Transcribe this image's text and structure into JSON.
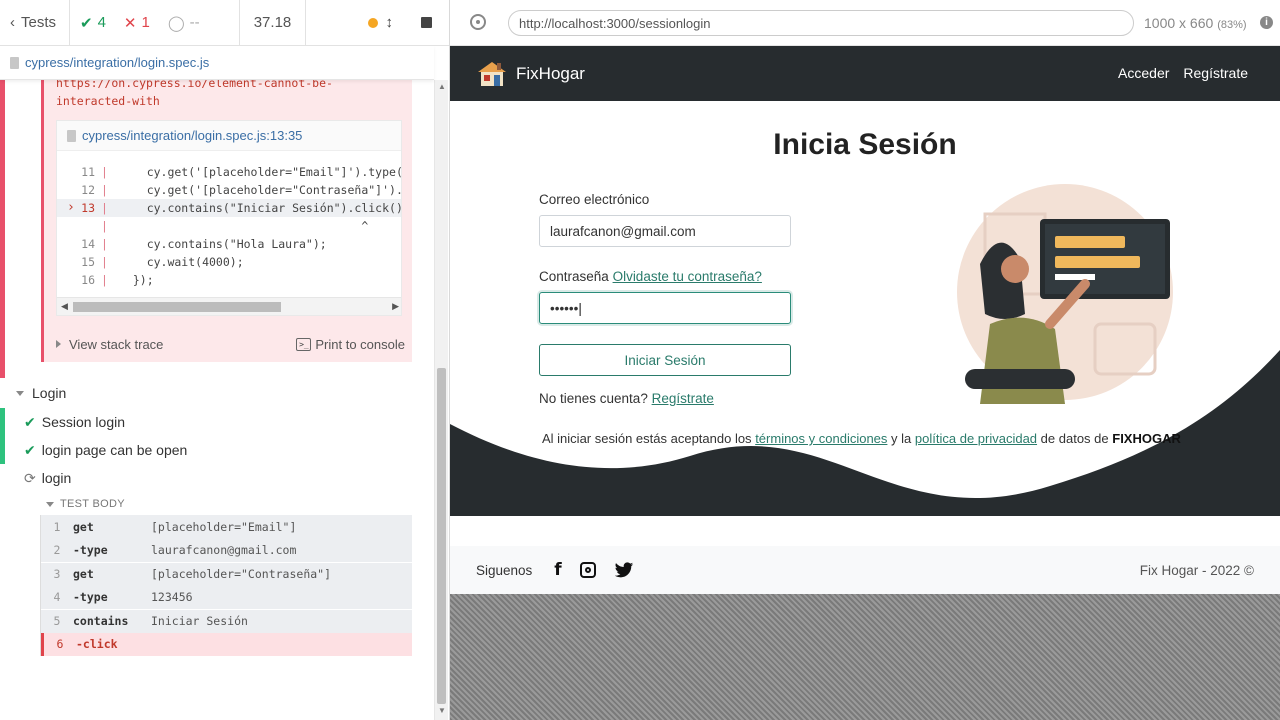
{
  "runner": {
    "tests_label": "Tests",
    "passed": "4",
    "failed": "1",
    "pending": "--",
    "duration": "37.18"
  },
  "spec": {
    "path": "cypress/integration/login.spec.js"
  },
  "error": {
    "link_text": "https://on.cypress.io/element-cannot-be-interacted-with",
    "frame_file": "cypress/integration/login.spec.js:13:35",
    "code_lines": [
      {
        "n": "11",
        "code": "    cy.get('[placeholder=\"Email\"]').type("
      },
      {
        "n": "12",
        "code": "    cy.get('[placeholder=\"Contraseña\"]')."
      },
      {
        "n": "13",
        "code": "    cy.contains(\"Iniciar Sesión\").click()"
      },
      {
        "n": "",
        "code": "                                   ^"
      },
      {
        "n": "14",
        "code": "    cy.contains(\"Hola Laura\");"
      },
      {
        "n": "15",
        "code": "    cy.wait(4000);"
      },
      {
        "n": "16",
        "code": "  });"
      }
    ],
    "view_stack": "View stack trace",
    "print_console": "Print to console"
  },
  "suite": {
    "title": "Login",
    "tests": [
      {
        "label": "Session login",
        "state": "passed"
      },
      {
        "label": "login page can be open",
        "state": "passed"
      },
      {
        "label": "login",
        "state": "running"
      }
    ],
    "body_header": "TEST BODY",
    "commands": [
      {
        "n": "1",
        "name": "get",
        "msg": "[placeholder=\"Email\"]"
      },
      {
        "n": "2",
        "name": "-type",
        "msg": "laurafcanon@gmail.com"
      },
      {
        "n": "3",
        "name": "get",
        "msg": "[placeholder=\"Contraseña\"]"
      },
      {
        "n": "4",
        "name": "-type",
        "msg": "123456"
      },
      {
        "n": "5",
        "name": "contains",
        "msg": "Iniciar Sesión"
      },
      {
        "n": "6",
        "name": "-click",
        "msg": ""
      }
    ]
  },
  "browser": {
    "url": "http://localhost:3000/sessionlogin",
    "viewport": "1000 x 660",
    "zoom": "(83%)"
  },
  "app": {
    "brand": "FixHogar",
    "nav_login": "Acceder",
    "nav_register": "Regístrate",
    "title": "Inicia Sesión",
    "email_label": "Correo electrónico",
    "email_value": "laurafcanon@gmail.com",
    "password_label": "Contraseña",
    "forgot_link": "Olvidaste tu contraseña?",
    "password_value": "••••••",
    "submit": "Iniciar Sesión",
    "no_account": "No tienes cuenta?",
    "register_link": "Regístrate",
    "terms_pre": "Al iniciar sesión estás aceptando los",
    "terms_link": "términos y condiciones",
    "terms_mid": "y la",
    "privacy_link": "política de privacidad",
    "terms_post": "de datos de",
    "terms_brand": "FIXHOGAR",
    "follow": "Siguenos",
    "copyright": "Fix Hogar - 2022 ©"
  },
  "colors": {
    "nav_bg": "#272c2f",
    "accent": "#2a7b6b",
    "pass": "#1a9b5a",
    "fail": "#e0444b"
  }
}
